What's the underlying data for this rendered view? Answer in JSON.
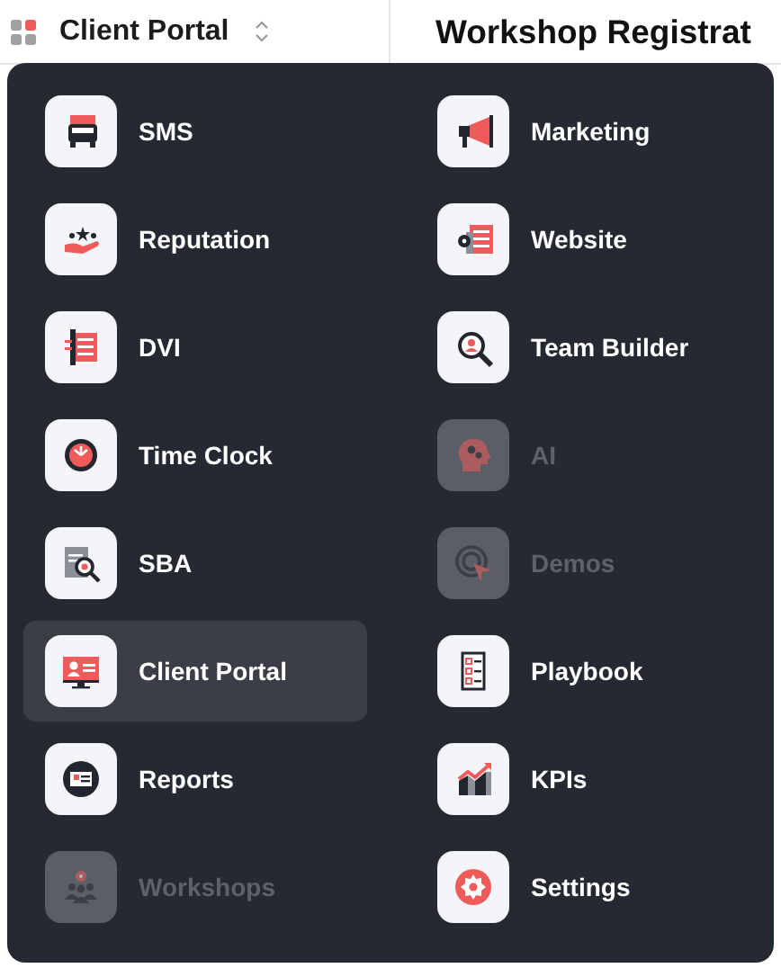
{
  "header": {
    "app_name": "Client Portal",
    "page_title": "Workshop Registrat"
  },
  "menu": {
    "items": [
      {
        "label": "SMS",
        "selected": false,
        "disabled": false
      },
      {
        "label": "Marketing",
        "selected": false,
        "disabled": false
      },
      {
        "label": "Reputation",
        "selected": false,
        "disabled": false
      },
      {
        "label": "Website",
        "selected": false,
        "disabled": false
      },
      {
        "label": "DVI",
        "selected": false,
        "disabled": false
      },
      {
        "label": "Team Builder",
        "selected": false,
        "disabled": false
      },
      {
        "label": "Time Clock",
        "selected": false,
        "disabled": false
      },
      {
        "label": "AI",
        "selected": false,
        "disabled": true
      },
      {
        "label": "SBA",
        "selected": false,
        "disabled": false
      },
      {
        "label": "Demos",
        "selected": false,
        "disabled": true
      },
      {
        "label": "Client Portal",
        "selected": true,
        "disabled": false
      },
      {
        "label": "Playbook",
        "selected": false,
        "disabled": false
      },
      {
        "label": "Reports",
        "selected": false,
        "disabled": false
      },
      {
        "label": "KPIs",
        "selected": false,
        "disabled": false
      },
      {
        "label": "Workshops",
        "selected": false,
        "disabled": true
      },
      {
        "label": "Settings",
        "selected": false,
        "disabled": false
      }
    ]
  }
}
